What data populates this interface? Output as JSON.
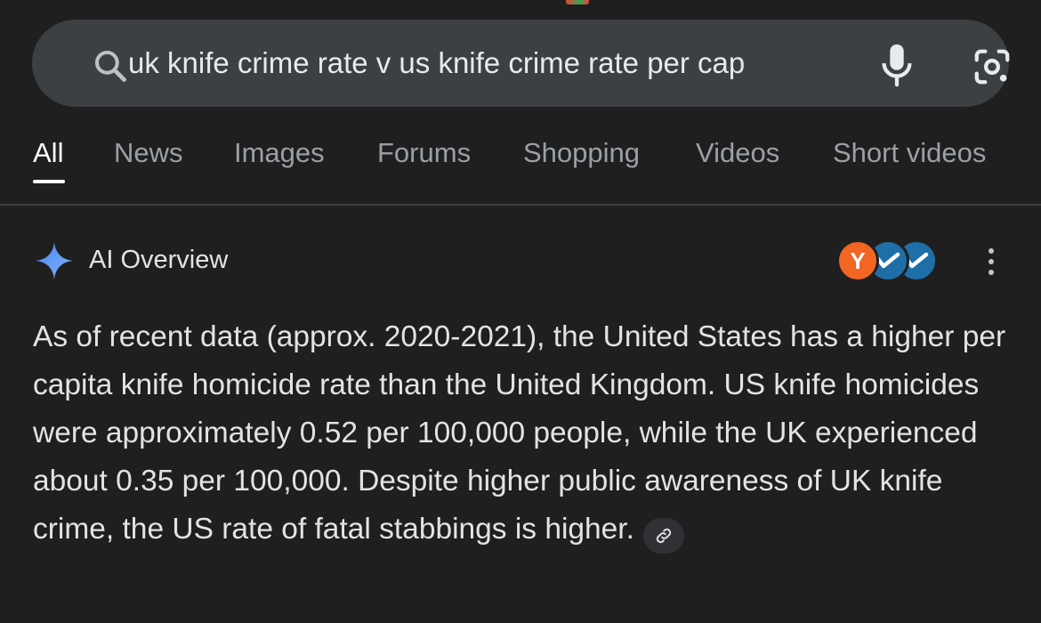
{
  "search": {
    "query": "uk knife crime rate v us knife crime rate per cap",
    "icons": [
      "search-icon",
      "mic-icon",
      "lens-icon"
    ]
  },
  "tabs": [
    {
      "label": "All",
      "active": true
    },
    {
      "label": "News",
      "active": false
    },
    {
      "label": "Images",
      "active": false
    },
    {
      "label": "Forums",
      "active": false
    },
    {
      "label": "Shopping",
      "active": false
    },
    {
      "label": "Videos",
      "active": false
    },
    {
      "label": "Short videos",
      "active": false
    }
  ],
  "ai_overview": {
    "title": "AI Overview",
    "source_badges": [
      {
        "letter": "Y",
        "color": "#f26522"
      },
      {
        "icon": "source-logo-icon",
        "color": "#1e6fa8"
      },
      {
        "icon": "source-logo-icon",
        "color": "#1e6fa8"
      }
    ],
    "body": "As of recent data (approx. 2020-2021), the United States has a higher per capita knife homicide rate than the United Kingdom. US knife homicides were approximately 0.52 per 100,000 people, while the UK experienced about 0.35 per 100,000. Despite higher public awareness of UK knife crime, the US rate of fatal stabbings is higher."
  },
  "colors": {
    "background": "#1f1f1f",
    "search_bar": "#3c4043",
    "active_tab": "#ffffff",
    "inactive_tab": "#9aa0a6",
    "ai_spark": "#8ab4f8"
  }
}
